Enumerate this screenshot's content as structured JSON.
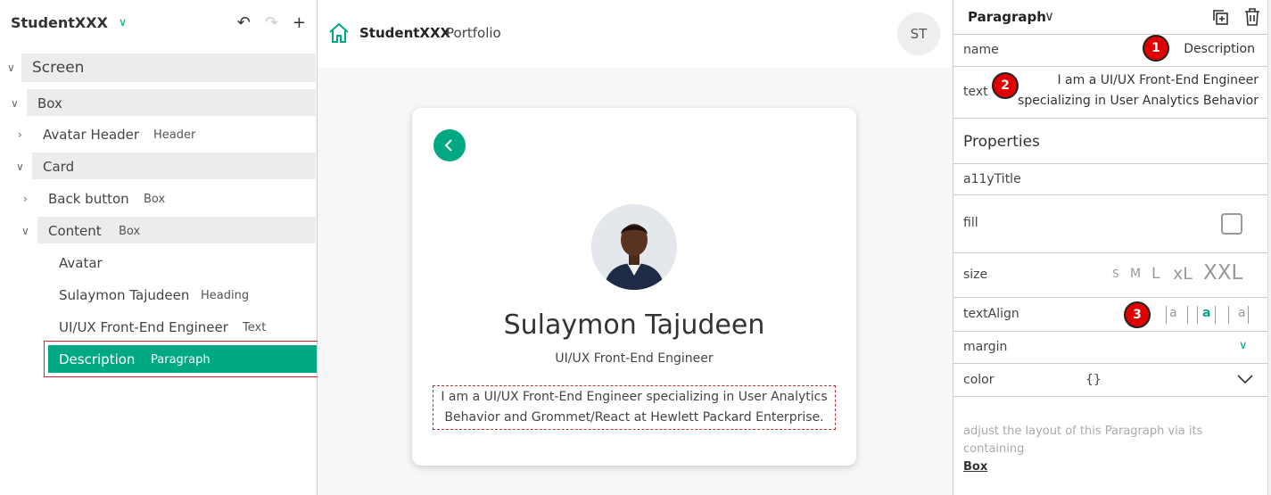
{
  "left_panel": {
    "app_title": "StudentXXX",
    "tree": {
      "screen": "Screen",
      "box": "Box",
      "avatar_header": {
        "label": "Avatar Header",
        "type": "Header"
      },
      "card": "Card",
      "back_button": {
        "label": "Back button",
        "type": "Box"
      },
      "content": {
        "label": "Content",
        "type": "Box"
      },
      "avatar": "Avatar",
      "heading": {
        "label": "Sulaymon Tajudeen",
        "type": "Heading"
      },
      "text": {
        "label": "UI/UX Front-End Engineer",
        "type": "Text"
      },
      "description": {
        "label": "Description",
        "type": "Paragraph"
      }
    }
  },
  "canvas": {
    "brand": "StudentXXX",
    "brand_sub": "Portfolio",
    "avatar_initials": "ST",
    "card": {
      "name": "Sulaymon Tajudeen",
      "role": "UI/UX Front-End Engineer",
      "description": "I am a UI/UX Front-End Engineer specializing in User Analytics Behavior and Grommet/React at Hewlett Packard Enterprise."
    }
  },
  "right_panel": {
    "title": "Paragraph",
    "name": {
      "label": "name",
      "value": "Description"
    },
    "text": {
      "label": "text",
      "value_line1": "I am a UI/UX Front-End Engineer",
      "value_line2": "specializing in User Analytics Behavior"
    },
    "properties_title": "Properties",
    "a11y": "a11yTitle",
    "fill": "fill",
    "size": {
      "label": "size",
      "options": [
        "S",
        "M",
        "L",
        "xL",
        "XXL"
      ]
    },
    "text_align": {
      "label": "textAlign",
      "options": [
        "a",
        "a",
        "a"
      ],
      "selected_index": 1
    },
    "margin": "margin",
    "color": {
      "label": "color",
      "value": "{}"
    },
    "hint": "adjust the layout of this Paragraph via its containing",
    "hint_link": "Box",
    "badges": [
      "1",
      "2",
      "3"
    ]
  },
  "colors": {
    "accent": "#01a982",
    "selection_outline": "#e02020",
    "badge": "#e00000"
  }
}
